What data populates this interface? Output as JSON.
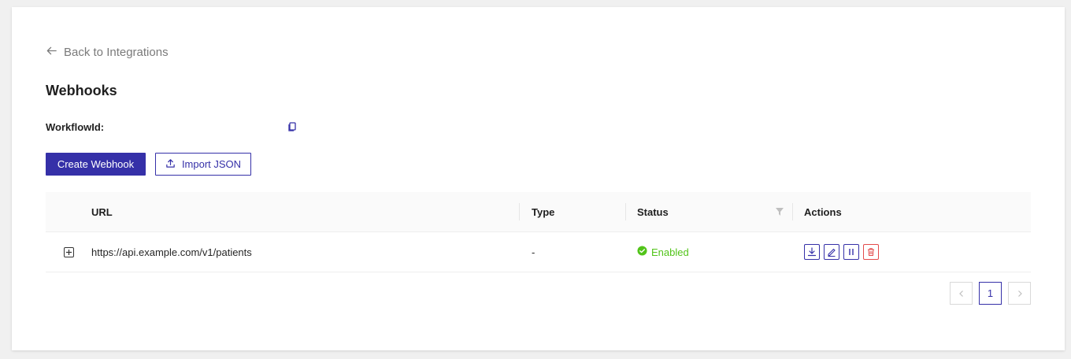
{
  "back_link": {
    "label": "Back to Integrations",
    "icon": "arrow-left-icon"
  },
  "page": {
    "title": "Webhooks"
  },
  "workflow": {
    "label": "WorkflowId:",
    "value": "",
    "copy_icon": "copy-icon"
  },
  "buttons": {
    "create": "Create Webhook",
    "import": "Import JSON"
  },
  "table": {
    "columns": [
      "URL",
      "Type",
      "Status",
      "Actions"
    ],
    "rows": [
      {
        "url": "https://api.example.com/v1/patients",
        "type": "-",
        "status": "Enabled"
      }
    ]
  },
  "pagination": {
    "current": "1"
  },
  "colors": {
    "primary": "#3530a8",
    "success": "#52c41a",
    "danger": "#e34b4b"
  }
}
